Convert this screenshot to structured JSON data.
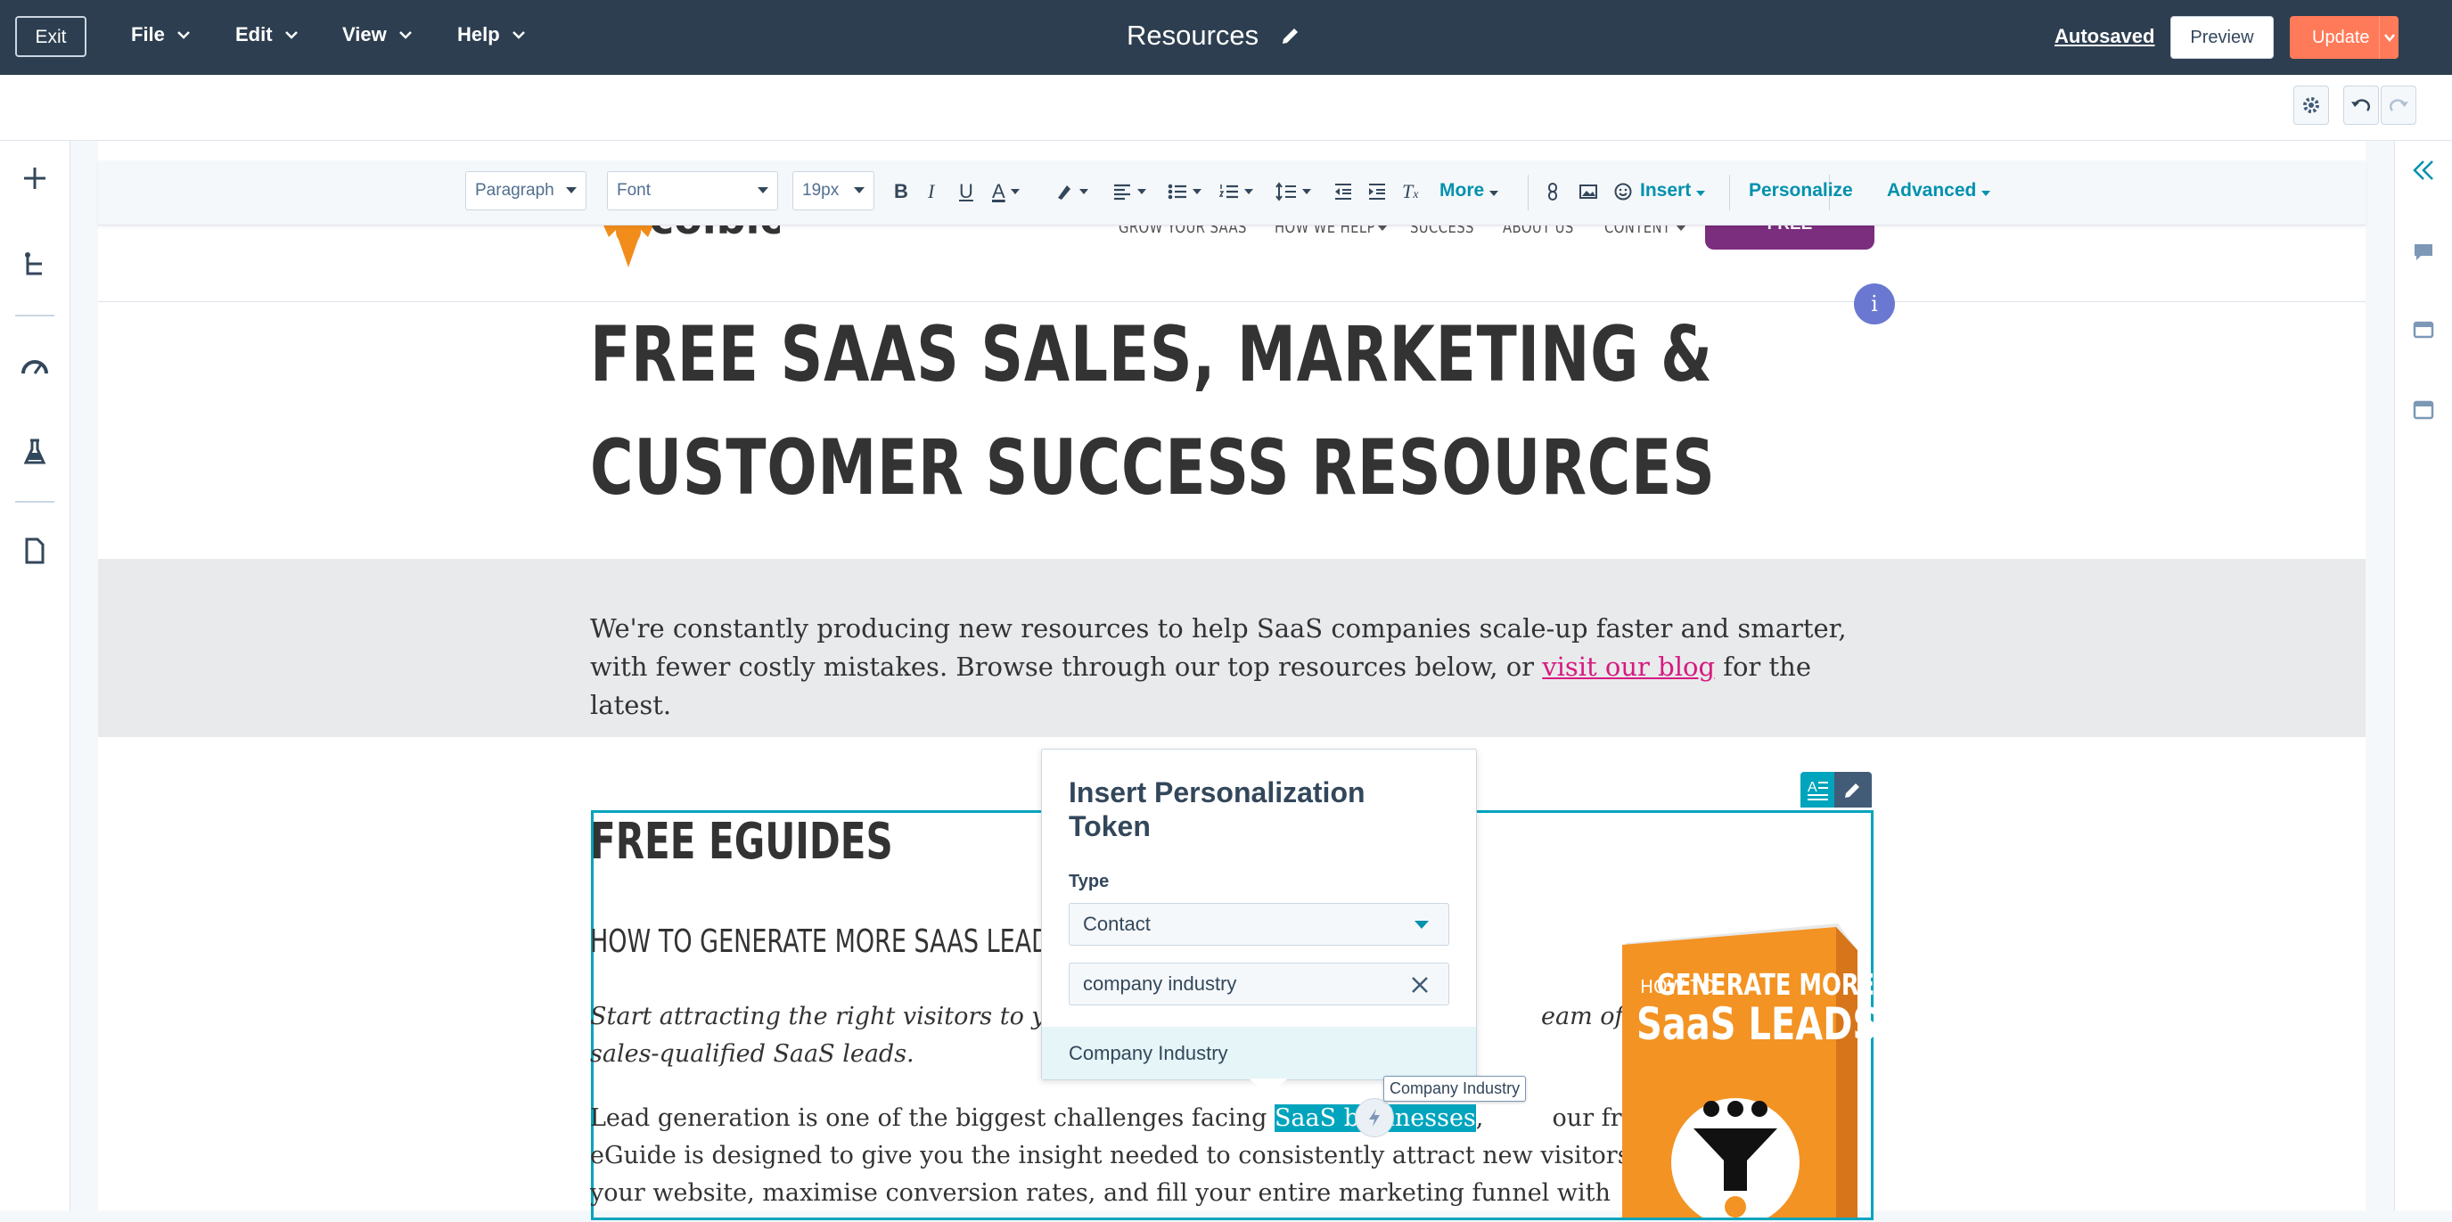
{
  "topbar": {
    "exit_label": "Exit",
    "menus": [
      "File",
      "Edit",
      "View",
      "Help"
    ],
    "page_title": "Resources",
    "autosaved": "Autosaved",
    "preview_label": "Preview",
    "update_label": "Update"
  },
  "toolbar": {
    "paragraph": "Paragraph",
    "font": "Font",
    "font_size": "19px",
    "more": "More",
    "insert": "Insert",
    "personalize": "Personalize",
    "advanced": "Advanced"
  },
  "site_nav": {
    "logo_text": "colbloom",
    "links": [
      "GROW YOUR SAAS",
      "HOW WE HELP",
      "SUCCESS",
      "ABOUT US",
      "CONTENT"
    ],
    "cta": "FREE CONSULTATION",
    "info": "i"
  },
  "page": {
    "headline_line1": "FREE SAAS SALES, MARKETING &",
    "headline_line2": "CUSTOMER SUCCESS RESOURCES",
    "intro_before": "We're constantly producing new resources to help SaaS companies scale-up faster and smarter, with fewer costly mistakes. Browse through our top resources below, or ",
    "intro_link": "visit our blog",
    "intro_after": " for the latest.",
    "section_title": "FREE EGUIDES",
    "guide_title": "HOW TO GENERATE MORE SAAS LEADS",
    "italic_line1_a": "Start attracting the right visitors to your w",
    "italic_line1_b": "eam of",
    "italic_line2": "sales-qualified SaaS leads.",
    "body_line1_a": "Lead generation is one of the biggest challenges facing ",
    "body_highlight": "SaaS businesses",
    "body_line1_b": ", ",
    "body_line1_c": " our free",
    "body_line2": "eGuide is designed to give you the insight needed to consistently attract new visitors to",
    "body_line3": "your website, maximise conversion rates, and fill your entire marketing funnel with",
    "book_text_1": "HOW TO",
    "book_text_2": "GENERATE MORE",
    "book_text_3": "SaaS LEADS"
  },
  "popup": {
    "title": "Insert Personalization Token",
    "type_label": "Type",
    "type_value": "Contact",
    "search_value": "company industry",
    "option": "Company Industry",
    "tooltip": "Company Industry"
  },
  "colors": {
    "topbar": "#2d3e50",
    "accent": "#00a4bd",
    "update": "#ff7a59",
    "cta": "#7b2d7e",
    "link": "#d61a7f"
  }
}
